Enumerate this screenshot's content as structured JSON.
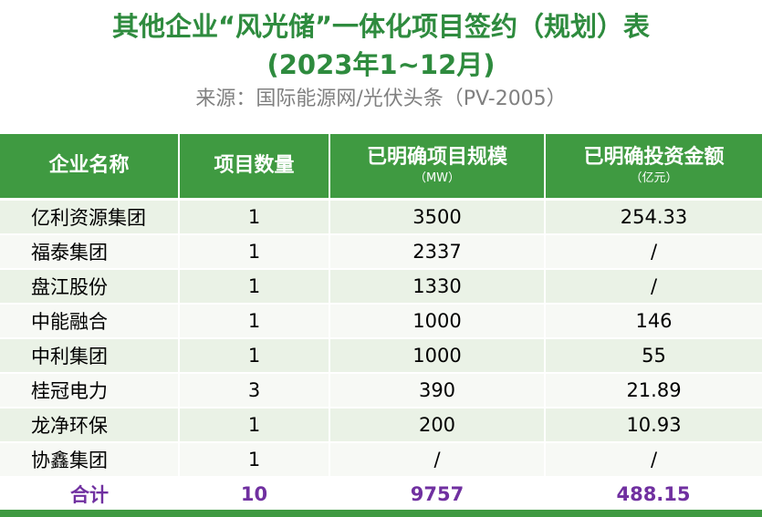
{
  "title": {
    "line1": "其他企业“风光储”一体化项目签约（规划）表",
    "line2": "(2023年1~12月)"
  },
  "source": "来源：国际能源网/光伏头条（PV-2005）",
  "colors": {
    "title": "#2e8b3e",
    "header_bg": "#3f9a41",
    "total_text": "#7030a0",
    "row_odd": "#eaf2e6",
    "row_even": "#f7f9f5"
  },
  "table": {
    "headers": [
      {
        "main": "企业名称",
        "sub": ""
      },
      {
        "main": "项目数量",
        "sub": ""
      },
      {
        "main": "已明确项目规模",
        "sub": "（MW）"
      },
      {
        "main": "已明确投资金额",
        "sub": "（亿元）"
      }
    ],
    "rows": [
      {
        "name": "亿利资源集团",
        "count": "1",
        "scale": "3500",
        "investment": "254.33"
      },
      {
        "name": "福泰集团",
        "count": "1",
        "scale": "2337",
        "investment": "/"
      },
      {
        "name": "盘江股份",
        "count": "1",
        "scale": "1330",
        "investment": "/"
      },
      {
        "name": "中能融合",
        "count": "1",
        "scale": "1000",
        "investment": "146"
      },
      {
        "name": "中利集团",
        "count": "1",
        "scale": "1000",
        "investment": "55"
      },
      {
        "name": "桂冠电力",
        "count": "3",
        "scale": "390",
        "investment": "21.89"
      },
      {
        "name": "龙净环保",
        "count": "1",
        "scale": "200",
        "investment": "10.93"
      },
      {
        "name": "协鑫集团",
        "count": "1",
        "scale": "/",
        "investment": "/"
      }
    ],
    "total": {
      "label": "合计",
      "count": "10",
      "scale": "9757",
      "investment": "488.15"
    }
  }
}
